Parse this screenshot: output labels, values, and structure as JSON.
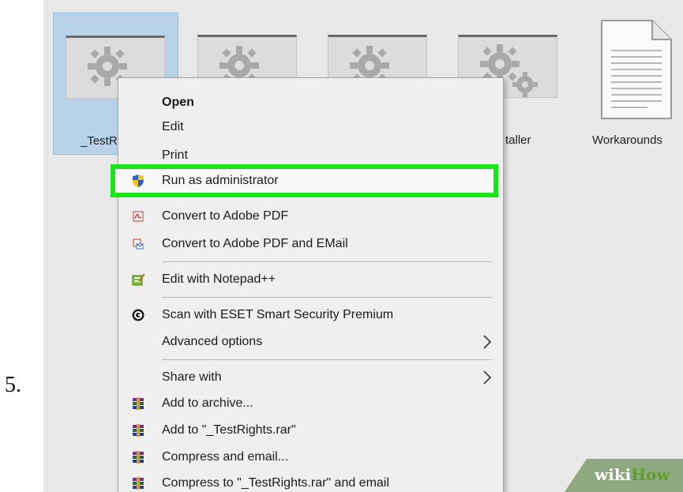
{
  "step_number": "5.",
  "desktop": {
    "files": [
      {
        "label": "_TestR",
        "selected": true
      },
      {
        "label": "",
        "selected": false
      },
      {
        "label": "",
        "selected": false
      },
      {
        "label": "taller",
        "selected": false
      },
      {
        "label": "Workarounds",
        "selected": false
      }
    ]
  },
  "context_menu": {
    "items": [
      {
        "label": "Open",
        "icon": "none"
      },
      {
        "label": "Edit",
        "icon": "none"
      },
      {
        "label": "Print",
        "icon": "none"
      },
      {
        "label": "Run as administrator",
        "icon": "uac-shield-icon"
      },
      {
        "label": "Convert to Adobe PDF",
        "icon": "adobe-pdf-icon"
      },
      {
        "label": "Convert to Adobe PDF and EMail",
        "icon": "adobe-pdf-email-icon"
      },
      {
        "label": "Edit with Notepad++",
        "icon": "notepad-plus-plus-icon"
      },
      {
        "label": "Scan with ESET Smart Security Premium",
        "icon": "eset-icon"
      },
      {
        "label": "Advanced options",
        "icon": "none"
      },
      {
        "label": "Share with",
        "icon": "none"
      },
      {
        "label": "Add to archive...",
        "icon": "winrar-icon"
      },
      {
        "label": "Add to \"_TestRights.rar\"",
        "icon": "winrar-icon"
      },
      {
        "label": "Compress and email...",
        "icon": "winrar-icon"
      },
      {
        "label": "Compress to \"_TestRights.rar\" and email",
        "icon": "winrar-icon"
      }
    ],
    "highlight_color": "#18e418"
  },
  "watermark": {
    "wiki": "wiki",
    "how": "How"
  }
}
